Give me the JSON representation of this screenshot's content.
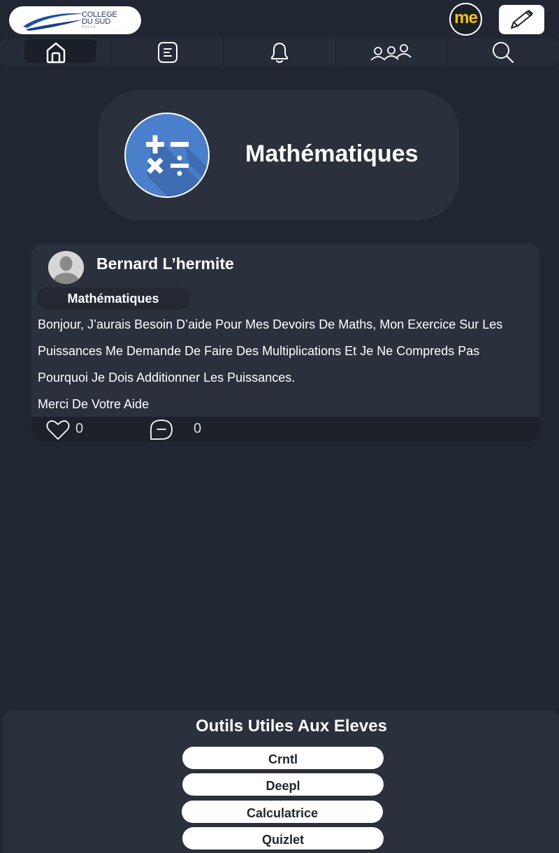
{
  "header": {
    "logo": {
      "line1": "COLLEGE",
      "line2": "DU SUD",
      "line3": "BULLE"
    },
    "me_label": "me",
    "edit_icon": "pencil-icon"
  },
  "nav": {
    "items": [
      {
        "name": "home",
        "icon": "home-icon",
        "active": true
      },
      {
        "name": "posts",
        "icon": "document-icon",
        "active": false
      },
      {
        "name": "notifications",
        "icon": "bell-icon",
        "active": false
      },
      {
        "name": "groups",
        "icon": "people-icon",
        "active": false
      },
      {
        "name": "search",
        "icon": "search-icon",
        "active": false
      }
    ]
  },
  "subject": {
    "title": "Mathématiques",
    "icon": "math-operators-icon",
    "icon_color": "#4a7fcb"
  },
  "post": {
    "author": "Bernard L’hermite",
    "tag": "Mathématiques",
    "lines": [
      "Bonjour, J’aurais Besoin D’aide Pour Mes Devoirs De Maths, Mon Exercice Sur Les",
      "Puissances Me Demande De Faire Des Multiplications Et Je Ne Compreds Pas",
      "Pourquoi Je Dois Additionner Les Puissances.",
      "Merci De Votre Aide"
    ],
    "likes": "0",
    "comments": "0"
  },
  "tools": {
    "title": "Outils Utiles Aux Eleves",
    "buttons": [
      "Crntl",
      "Deepl",
      "Calculatrice",
      "Quizlet"
    ]
  },
  "colors": {
    "background": "#202632",
    "card": "#2a303c",
    "accent_yellow": "#f0c419",
    "logo_blue": "#2b3a66"
  }
}
